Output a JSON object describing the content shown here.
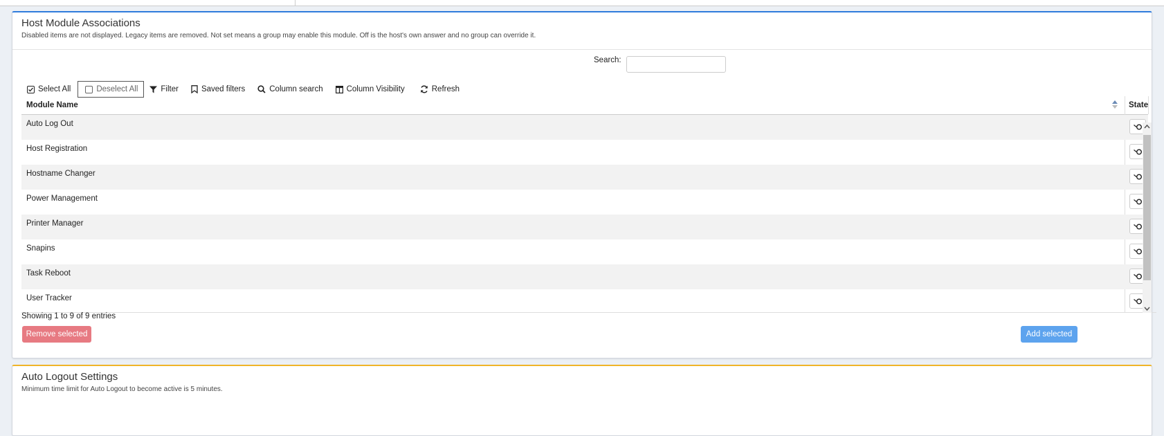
{
  "host_modules": {
    "title": "Host Module Associations",
    "subtitle": "Disabled items are not displayed. Legacy items are removed. Not set means a group may enable this module. Off is the host's own answer and no group can override it.",
    "search_label": "Search:",
    "search_value": "",
    "toolbar": {
      "select_all": "Select All",
      "deselect_all": "Deselect All",
      "filter": "Filter",
      "saved_filters": "Saved filters",
      "column_search": "Column search",
      "column_visibility": "Column Visibility",
      "refresh": "Refresh"
    },
    "columns": [
      "Module Name",
      "State"
    ],
    "rows": [
      {
        "name": "Auto Log Out"
      },
      {
        "name": "Host Registration"
      },
      {
        "name": "Hostname Changer"
      },
      {
        "name": "Power Management"
      },
      {
        "name": "Printer Manager"
      },
      {
        "name": "Snapins"
      },
      {
        "name": "Task Reboot"
      },
      {
        "name": "User Tracker"
      }
    ],
    "info": "Showing 1 to 9 of 9 entries",
    "remove_label": "Remove selected",
    "add_label": "Add selected"
  },
  "auto_logout": {
    "title": "Auto Logout Settings",
    "subtitle": "Minimum time limit for Auto Logout to become active is 5 minutes."
  },
  "colors": {
    "primary_border": "#2f7bdc",
    "warning_border": "#f0b428",
    "danger_button": "#e77a82",
    "primary_button": "#5da3ee"
  }
}
